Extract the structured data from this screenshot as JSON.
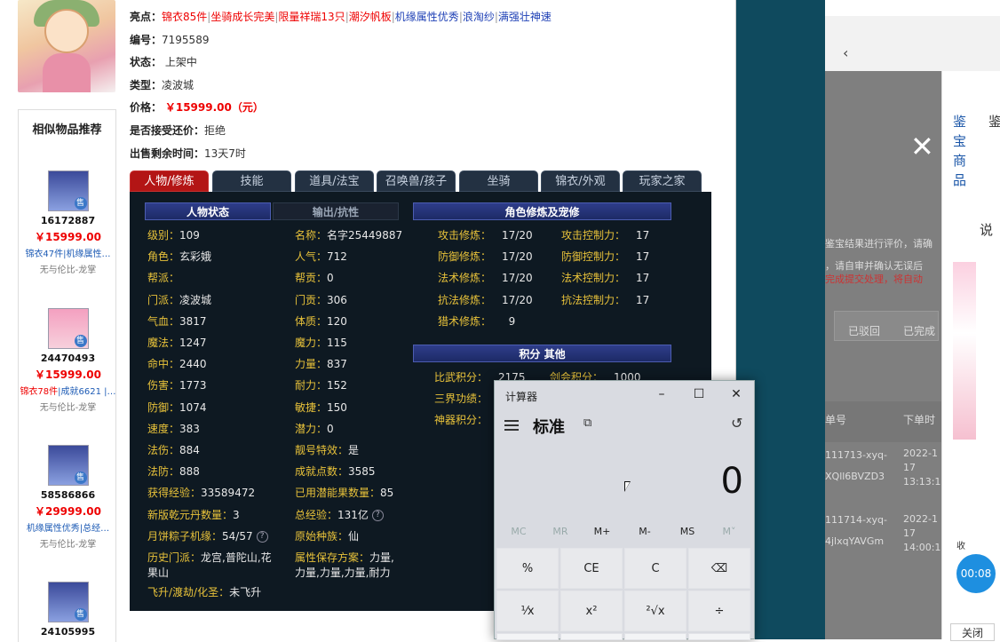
{
  "left": {
    "similar_title": "相似物品推荐",
    "items": [
      {
        "id": "16172887",
        "price": "￥15999.00",
        "tags_a": "锦衣47件",
        "tags_b": "|机缘属性…",
        "store": "无与伦比-龙掌",
        "tag": "售"
      },
      {
        "id": "24470493",
        "price": "￥15999.00",
        "tags_a": "锦衣78件",
        "tags_b": "|成就6621 |…",
        "store": "无与伦比-龙掌",
        "tag": "售"
      },
      {
        "id": "58586866",
        "price": "￥29999.00",
        "tags_a": "机缘属性优秀",
        "tags_b": "|总经…",
        "store": "无与伦比-龙掌",
        "tag": "售"
      },
      {
        "id": "24105995",
        "tag": "售"
      }
    ]
  },
  "info": {
    "highlight_label": "亮点：",
    "highlights": [
      "锦衣85件",
      "坐骑成长完美",
      "限量祥瑞13只",
      "潮汐帆板",
      "机缘属性优秀",
      "浪淘纱",
      "满强壮神速"
    ],
    "serial_label": "编号：",
    "serial": "7195589",
    "status_label": "状态：",
    "status": "上架中",
    "type_label": "类型：",
    "type": "凌波城",
    "price_label": "价格：",
    "price": "￥15999.00（元）",
    "bargain_label": "是否接受还价：",
    "bargain": "拒绝",
    "remain_label": "出售剩余时间：",
    "remain": "13天7时"
  },
  "tabs": [
    "人物/修炼",
    "技能",
    "道具/法宝",
    "召唤兽/孩子",
    "坐骑",
    "锦衣/外观",
    "玩家之家"
  ],
  "panel": {
    "h_status": "人物状态",
    "h_output": "输出/抗性",
    "h_cultivation": "角色修炼及宠修",
    "h_points": "积分  其他",
    "col1": [
      {
        "k": "级别：",
        "v": "109"
      },
      {
        "k": "角色：",
        "v": "玄彩娥"
      },
      {
        "k": "帮派：",
        "v": ""
      },
      {
        "k": "门派：",
        "v": "凌波城"
      },
      {
        "k": "气血：",
        "v": "3817"
      },
      {
        "k": "魔法：",
        "v": "1247"
      },
      {
        "k": "命中：",
        "v": "2440"
      },
      {
        "k": "伤害：",
        "v": "1773"
      },
      {
        "k": "防御：",
        "v": "1074"
      },
      {
        "k": "速度：",
        "v": "383"
      },
      {
        "k": "法伤：",
        "v": "884"
      },
      {
        "k": "法防：",
        "v": "888"
      },
      {
        "k": "获得经验：",
        "v": "33589472"
      },
      {
        "k": "新版乾元丹数量：",
        "v": "3"
      },
      {
        "k": "月饼粽子机缘：",
        "v": "54/57"
      }
    ],
    "col2": [
      {
        "k": "名称：",
        "v": "名字25449887"
      },
      {
        "k": "人气：",
        "v": "712"
      },
      {
        "k": "帮贡：",
        "v": "0"
      },
      {
        "k": "门贡：",
        "v": "306"
      },
      {
        "k": "体质：",
        "v": "120"
      },
      {
        "k": "魔力：",
        "v": "115"
      },
      {
        "k": "力量：",
        "v": "837"
      },
      {
        "k": "耐力：",
        "v": "152"
      },
      {
        "k": "敏捷：",
        "v": "150"
      },
      {
        "k": "潜力：",
        "v": "0"
      },
      {
        "k": "靓号特效：",
        "v": "是"
      },
      {
        "k": "成就点数：",
        "v": "3585"
      },
      {
        "k": "已用潜能果数量：",
        "v": "85"
      },
      {
        "k": "总经验：",
        "v": "131亿"
      },
      {
        "k": "原始种族：",
        "v": "仙"
      }
    ],
    "history_k": "历史门派：",
    "history_v": "龙宫,普陀山,花果山",
    "save_k": "属性保存方案：",
    "save_v": "力量,力量,力量,力量,耐力",
    "fly_k": "飞升/渡劫/化圣：",
    "fly_v": "未飞升",
    "cult": [
      {
        "k": "攻击修炼：",
        "v": "17/20",
        "k2": "攻击控制力：",
        "v2": "17"
      },
      {
        "k": "防御修炼：",
        "v": "17/20",
        "k2": "防御控制力：",
        "v2": "17"
      },
      {
        "k": "法术修炼：",
        "v": "17/20",
        "k2": "法术控制力：",
        "v2": "17"
      },
      {
        "k": "抗法修炼：",
        "v": "17/20",
        "k2": "抗法控制力：",
        "v2": "17"
      }
    ],
    "hunt_k": "猎术修炼：",
    "hunt_v": "9",
    "points": [
      {
        "k": "比武积分：",
        "v": "2175",
        "k2": "剑会积分：",
        "v2": "1000"
      },
      {
        "k": "三界功绩：",
        "v": ""
      },
      {
        "k": "神器积分：",
        "v": ""
      }
    ]
  },
  "calculator": {
    "title": "计算器",
    "mode": "标准",
    "display": "0",
    "mem": [
      "MC",
      "MR",
      "M+",
      "M-",
      "MS",
      "M˅"
    ],
    "keys_row1": [
      "%",
      "CE",
      "C",
      "⌫"
    ],
    "keys_row2": [
      "¹⁄x",
      "x²",
      "²√x",
      "÷"
    ]
  },
  "right_window": {
    "side_text": [
      "鉴",
      "宝",
      "商",
      "品"
    ],
    "tab2": "鉴",
    "btn_rejected": "已驳回",
    "btn_done": "已完成",
    "col_no": "单号",
    "col_time": "下单时",
    "order1_no": "111713-xyq-",
    "order1_no2": "XQll6BVZD3",
    "order1_date": "2022-1",
    "order1_date2": "17",
    "order1_time": "13:13:1",
    "order2_no": "111714-xyq-",
    "order2_no2": "4jlxqYAVGm",
    "order2_date": "2022-1",
    "order2_date2": "17",
    "order2_time": "14:00:1",
    "text_a": "鉴宝结果进行评价，请确",
    "text_b": "，请自审并确认无误后",
    "text_c": "完成提交处理，将自动",
    "side_char": "说",
    "close_label": "关闭",
    "timer": "00:08",
    "shou": "收"
  },
  "colors": {
    "accent_red": "#e00000",
    "panel_bg": "#0e1922",
    "label_gold": "#e8c23a",
    "tab_active": "#b31515"
  }
}
